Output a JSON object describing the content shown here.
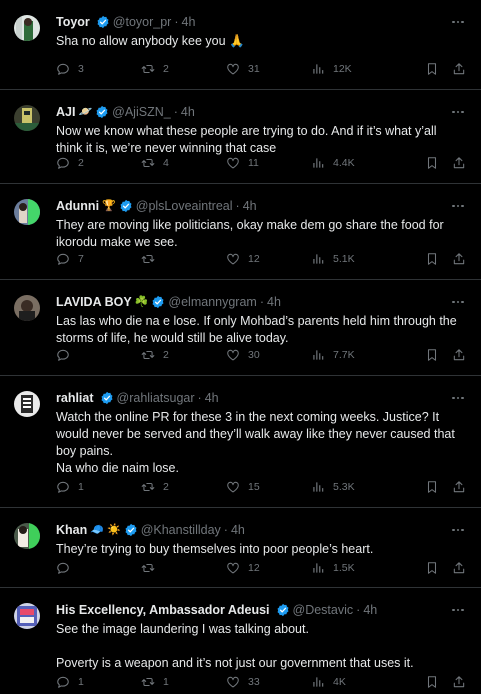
{
  "colors": {
    "background": "#000000",
    "text": "#e7e9ea",
    "secondary_text": "#71767b",
    "divider": "#2f3336",
    "verified_badge": "#1d9bf0"
  },
  "icons": {
    "verified": "verified-badge-icon",
    "more": "more-dots-icon",
    "reply": "reply-icon",
    "retweet": "retweet-icon",
    "like": "like-icon",
    "views": "views-icon",
    "bookmark": "bookmark-icon",
    "share": "share-icon"
  },
  "tweets": [
    {
      "name": "Toyor",
      "name_emoji": "",
      "handle": "@toyor_pr",
      "separator": "·",
      "time": "4h",
      "text": "Sha no allow anybody kee you 🙏",
      "replies": "3",
      "retweets": "2",
      "likes": "31",
      "views": "12K"
    },
    {
      "name": "AJI",
      "name_emoji": "🪐",
      "handle": "@AjiSZN_",
      "separator": "·",
      "time": "4h",
      "text": "Now we know what these people are trying to do. And if it’s what y’all think it is, we’re never winning that case",
      "replies": "2",
      "retweets": "4",
      "likes": "11",
      "views": "4.4K"
    },
    {
      "name": "Adunni",
      "name_emoji": "🏆",
      "handle": "@plsLoveaintreal",
      "separator": "·",
      "time": "4h",
      "text": "They are moving like politicians, okay make dem go share the food for ikorodu make we see.",
      "replies": "7",
      "retweets": "",
      "likes": "12",
      "views": "5.1K"
    },
    {
      "name": "LAVIDA BOY",
      "name_emoji": "☘️",
      "handle": "@elmannygram",
      "separator": "·",
      "time": "4h",
      "text": "Las las who die na e lose. If only Mohbad’s parents held him through the storms of life, he would still be alive today.",
      "replies": "",
      "retweets": "2",
      "likes": "30",
      "views": "7.7K"
    },
    {
      "name": "rahliat",
      "name_emoji": "",
      "handle": "@rahliatsugar",
      "separator": "·",
      "time": "4h",
      "text": "Watch the online PR for these 3 in the next coming weeks. Justice? It would never be served and they’ll walk away like they never caused that boy pains.\nNa who die naim lose.",
      "replies": "1",
      "retweets": "2",
      "likes": "15",
      "views": "5.3K"
    },
    {
      "name": "Khan",
      "name_emoji": "🧢 ☀️",
      "handle": "@Khanstillday",
      "separator": "·",
      "time": "4h",
      "text": "They’re trying to buy themselves into poor people’s heart.",
      "replies": "",
      "retweets": "",
      "likes": "12",
      "views": "1.5K"
    },
    {
      "name": "His Excellency, Ambassador Adeusi",
      "name_emoji": "",
      "handle": "@Destavic",
      "separator": "·",
      "time": "4h",
      "text": "See the image laundering I was talking about.\n\nPoverty is a weapon and it’s not just our government that uses it.",
      "replies": "1",
      "retweets": "1",
      "likes": "33",
      "views": "4K"
    }
  ]
}
